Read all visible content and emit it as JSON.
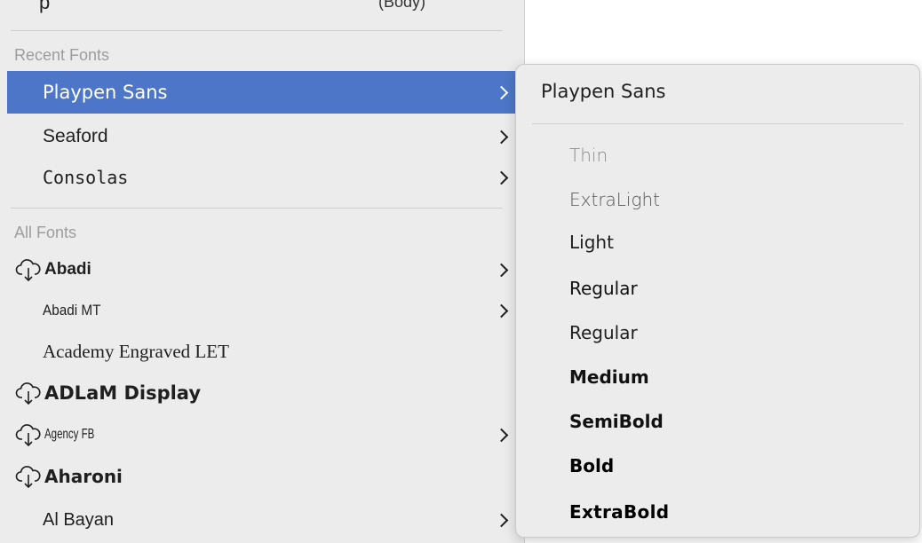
{
  "menu": {
    "top_row": {
      "left_text": "p",
      "right_text": "(Body)"
    },
    "recent_header": "Recent Fonts",
    "recent_fonts": [
      {
        "label": "Playpen Sans",
        "has_submenu": true,
        "selected": true
      },
      {
        "label": "Seaford",
        "has_submenu": true
      },
      {
        "label": "Consolas",
        "has_submenu": true
      }
    ],
    "all_header": "All Fonts",
    "all_fonts": [
      {
        "label": "Abadi",
        "has_submenu": true,
        "cloud_icon": true
      },
      {
        "label": "Abadi MT",
        "has_submenu": true,
        "cloud_icon": false
      },
      {
        "label": "Academy Engraved LET",
        "has_submenu": false,
        "cloud_icon": false
      },
      {
        "label": "ADLaM Display",
        "has_submenu": false,
        "cloud_icon": true
      },
      {
        "label": "Agency FB",
        "has_submenu": true,
        "cloud_icon": true
      },
      {
        "label": "Aharoni",
        "has_submenu": false,
        "cloud_icon": true
      },
      {
        "label": "Al Bayan",
        "has_submenu": true,
        "cloud_icon": false
      }
    ],
    "icons": {
      "submenu": "chevron-right-icon",
      "download": "cloud-download-icon"
    },
    "colors": {
      "selection": "#4d76c8",
      "header_text": "#9d9d9d"
    }
  },
  "submenu": {
    "title": "Playpen Sans",
    "weights": [
      "Thin",
      "ExtraLight",
      "Light",
      "Regular",
      "Regular",
      "Medium",
      "SemiBold",
      "Bold",
      "ExtraBold"
    ]
  }
}
